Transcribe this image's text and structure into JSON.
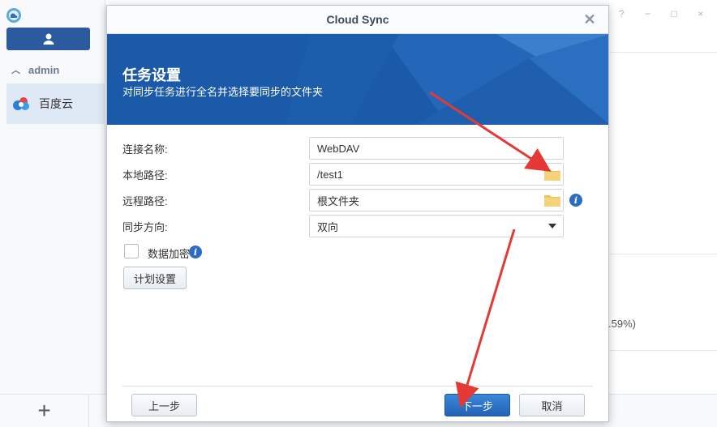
{
  "app": {
    "username": "admin",
    "service_name": "百度云",
    "add_label": "+",
    "window_controls": [
      "?",
      "−",
      "□",
      "×"
    ],
    "partial_text": ".59%)"
  },
  "dialog": {
    "title": "Cloud Sync",
    "close_icon": "close-icon",
    "banner_title": "任务设置",
    "banner_subtitle": "对同步任务进行全名并选择要同步的文件夹",
    "fields": {
      "connection_name": {
        "label": "连接名称:",
        "value": "WebDAV"
      },
      "local_path": {
        "label": "本地路径:",
        "value": "/test1"
      },
      "remote_path": {
        "label": "远程路径:",
        "value": "根文件夹"
      },
      "sync_direction": {
        "label": "同步方向:",
        "value": "双向"
      }
    },
    "encrypt_label": "数据加密",
    "schedule_button": "计划设置",
    "prev_button": "上一步",
    "next_button": "下一步",
    "cancel_button": "取消",
    "colors": {
      "banner": "#1b5aa8",
      "primary": "#2462b4",
      "annotation": "#e53935"
    }
  }
}
